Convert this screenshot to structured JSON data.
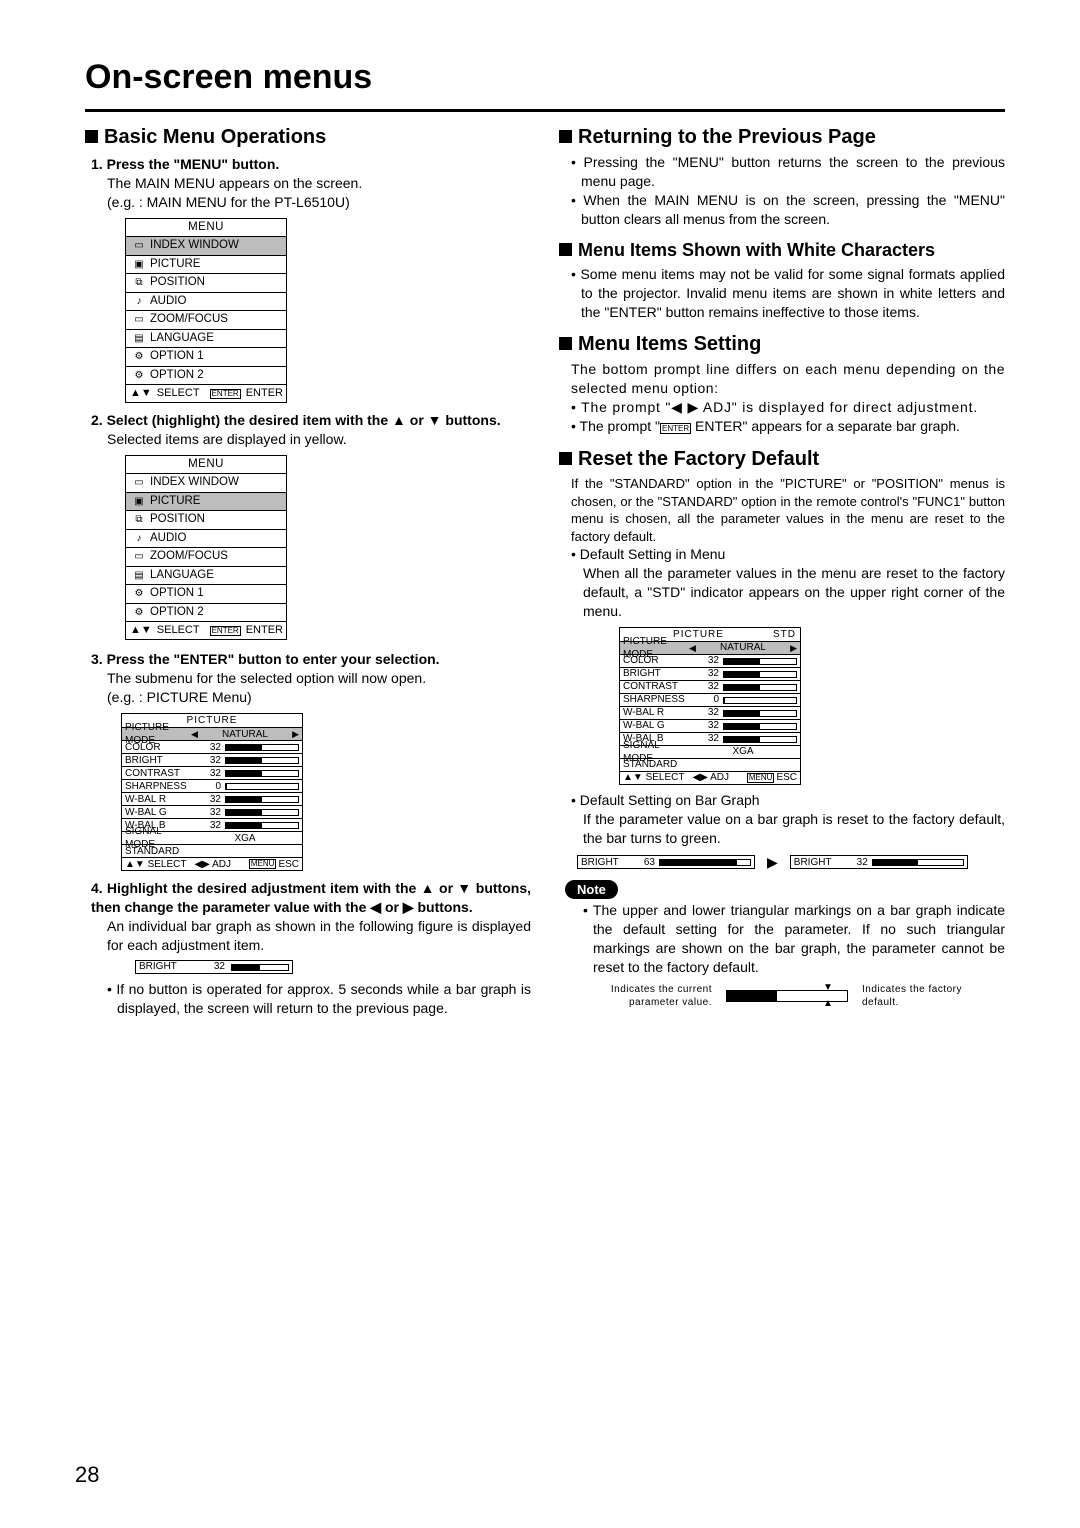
{
  "title": "On-screen menus",
  "page_number": "28",
  "left": {
    "h_basic": "Basic Menu Operations",
    "step1": "1. Press the \"MENU\" button.",
    "step1_body1": "The MAIN MENU appears on the screen.",
    "step1_body2": "(e.g. : MAIN MENU for the PT-L6510U)",
    "menu": {
      "title": "MENU",
      "items": [
        "INDEX WINDOW",
        "PICTURE",
        "POSITION",
        "AUDIO",
        "ZOOM/FOCUS",
        "LANGUAGE",
        "OPTION 1",
        "OPTION 2"
      ],
      "footer_select": "SELECT",
      "footer_enter": "ENTER",
      "footer_enterbox": "ENTER"
    },
    "step2": "2. Select (highlight) the desired item with the ▲ or ▼ buttons.",
    "step2_body": "Selected items are displayed in yellow.",
    "step3": "3. Press the \"ENTER\" button to enter your selection.",
    "step3_body1": "The submenu for the selected option will now open.",
    "step3_body2": "(e.g. :  PICTURE Menu)",
    "picture": {
      "title": "PICTURE",
      "rows": [
        {
          "lbl": "PICTURE MODE",
          "val": "NATURAL",
          "type": "mode"
        },
        {
          "lbl": "COLOR",
          "val": "32",
          "fill": 50
        },
        {
          "lbl": "BRIGHT",
          "val": "32",
          "fill": 50
        },
        {
          "lbl": "CONTRAST",
          "val": "32",
          "fill": 50
        },
        {
          "lbl": "SHARPNESS",
          "val": "0",
          "fill": 2
        },
        {
          "lbl": "W-BAL R",
          "val": "32",
          "fill": 50
        },
        {
          "lbl": "W-BAL G",
          "val": "32",
          "fill": 50
        },
        {
          "lbl": "W-BAL B",
          "val": "32",
          "fill": 50
        },
        {
          "lbl": "SIGNAL MODE",
          "val": "XGA",
          "type": "text"
        },
        {
          "lbl": "STANDARD",
          "val": "",
          "type": "blank"
        }
      ],
      "footer_select": "SELECT",
      "footer_adj": "ADJ",
      "footer_esc": "ESC",
      "footer_menubox": "MENU"
    },
    "step4": "4. Highlight the desired adjustment item with the ▲ or ▼ buttons, then change the parameter value with the ◀ or ▶ buttons.",
    "step4_body": "An individual bar graph as shown in the following figure is displayed for each adjustment item.",
    "bar_inline": {
      "lbl": "BRIGHT",
      "val": "32",
      "fill": 50
    },
    "step4_note": "If no button is operated for approx. 5 seconds while a bar graph is displayed, the screen will return to the previous page."
  },
  "right": {
    "h_return": "Returning to the Previous Page",
    "return_b1": "Pressing the \"MENU\" button returns the screen to the previous menu page.",
    "return_b2": "When the MAIN MENU is on the screen, pressing the \"MENU\" button clears all menus from the screen.",
    "h_white": "Menu Items Shown with White Characters",
    "white_b1": "Some menu items may not be valid for some signal formats applied to the projector. Invalid menu items are shown in white letters and the \"ENTER\" button remains ineffective to those items.",
    "h_setting": "Menu Items Setting",
    "setting_body": "The bottom prompt line differs on each menu depending on the selected menu option:",
    "setting_b1": "The prompt \"◀ ▶ ADJ\" is displayed for direct adjustment.",
    "setting_b2_pre": "The prompt \"",
    "setting_b2_box": "ENTER",
    "setting_b2_post": " ENTER\" appears for a separate bar graph.",
    "h_reset": "Reset the Factory Default",
    "reset_body": "If the \"STANDARD\" option in the \"PICTURE\" or \"POSITION\" menus is chosen, or the \"STANDARD\" option in the remote control's \"FUNC1\" button menu is chosen, all the parameter values in the menu are reset to the factory default.",
    "reset_b1": "Default Setting in Menu",
    "reset_b1_body": "When all the parameter values in the menu are reset to the factory default, a \"STD\" indicator appears on the upper right corner of the menu.",
    "picture_std": {
      "title": "PICTURE",
      "std": "STD",
      "rows": [
        {
          "lbl": "PICTURE MODE",
          "val": "NATURAL",
          "type": "mode"
        },
        {
          "lbl": "COLOR",
          "val": "32",
          "fill": 50
        },
        {
          "lbl": "BRIGHT",
          "val": "32",
          "fill": 50
        },
        {
          "lbl": "CONTRAST",
          "val": "32",
          "fill": 50
        },
        {
          "lbl": "SHARPNESS",
          "val": "0",
          "fill": 2
        },
        {
          "lbl": "W-BAL R",
          "val": "32",
          "fill": 50
        },
        {
          "lbl": "W-BAL G",
          "val": "32",
          "fill": 50
        },
        {
          "lbl": "W-BAL B",
          "val": "32",
          "fill": 50
        },
        {
          "lbl": "SIGNAL MODE",
          "val": "XGA",
          "type": "text"
        },
        {
          "lbl": "STANDARD",
          "val": "",
          "type": "blank"
        }
      ],
      "footer_select": "SELECT",
      "footer_adj": "ADJ",
      "footer_esc": "ESC",
      "footer_menubox": "MENU"
    },
    "reset_b2": "Default Setting on Bar Graph",
    "reset_b2_body": "If the parameter value on a bar graph is reset to the factory default, the bar turns to green.",
    "bar_before": {
      "lbl": "BRIGHT",
      "val": "63",
      "fill": 85
    },
    "bar_after": {
      "lbl": "BRIGHT",
      "val": "32",
      "fill": 50
    },
    "note_label": "Note",
    "note_b1": "The upper and lower triangular markings on a bar graph indicate the default setting for the parameter. If no such triangular markings are shown on the bar graph, the parameter cannot be reset to the factory default.",
    "tri_left": "Indicates the current parameter value.",
    "tri_right": "Indicates the factory default."
  }
}
